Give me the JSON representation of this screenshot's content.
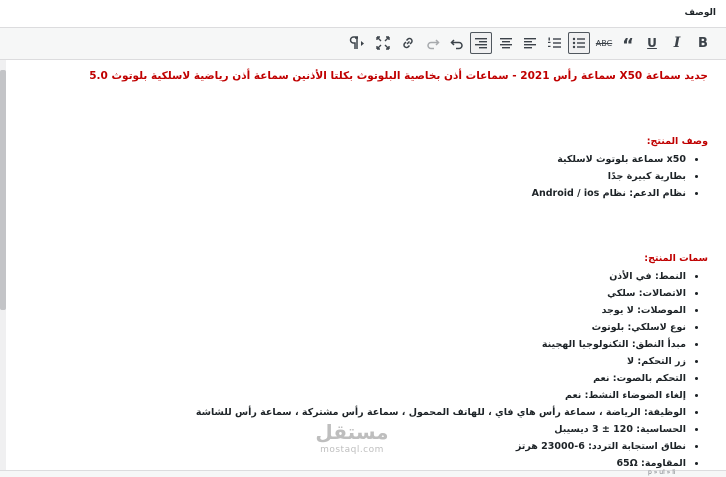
{
  "field_label": "الوصف",
  "toolbar": {
    "buttons": [
      {
        "name": "bold",
        "label": "B",
        "icon": "bold-icon"
      },
      {
        "name": "italic",
        "label": "I",
        "icon": "italic-icon"
      },
      {
        "name": "underline",
        "label": "U",
        "icon": "underline-icon"
      },
      {
        "name": "blockquote",
        "label": "“",
        "icon": "blockquote-icon"
      },
      {
        "name": "strikethrough",
        "label": "ABC",
        "icon": "strikethrough-icon"
      },
      {
        "name": "bullet-list",
        "icon": "bullet-list-icon",
        "active": true
      },
      {
        "name": "numbered-list",
        "icon": "numbered-list-icon"
      },
      {
        "name": "align-left",
        "icon": "align-left-icon"
      },
      {
        "name": "align-center",
        "icon": "align-center-icon"
      },
      {
        "name": "align-right",
        "icon": "align-right-icon",
        "active": true
      },
      {
        "name": "undo",
        "icon": "undo-icon"
      },
      {
        "name": "redo",
        "icon": "redo-icon",
        "disabled": true
      },
      {
        "name": "link",
        "icon": "link-icon"
      },
      {
        "name": "fullscreen",
        "icon": "fullscreen-icon"
      },
      {
        "name": "paragraph-direction",
        "icon": "pilcrow-rtl-icon"
      }
    ]
  },
  "content": {
    "headline": "جديد سماعة X50 سماعة رأس 2021 - سماعات أذن بخاصية البلوتوث بكلتا الأذنين سماعة أذن رياضية لاسلكية بلوتوث 5.0",
    "description_title": "وصف المنتج:",
    "description_items": [
      "x50 سماعة بلوتوث لاسلكية",
      "بطارية كبيرة جدًا",
      "نظام الدعم: نظام Android / ios"
    ],
    "features_title": "سمات المنتج:",
    "features_items": [
      "النمط: في الأذن",
      "الاتصالات: سلكي",
      "الموصلات: لا يوجد",
      "نوع لاسلكي: بلوتوث",
      "مبدأ النطق: التكنولوجيا الهجينة",
      "زر التحكم: لا",
      "التحكم بالصوت: نعم",
      "إلغاء الضوضاء النشط: نعم",
      "الوظيفة: الرياضة ، سماعة رأس هاي فاي ، للهاتف المحمول ، سماعة رأس مشتركة ، سماعة رأس للشاشة",
      "الحساسية: 120 ± 3 ديسيبل",
      "نطاق استجابة التردد: 6-23000 هرتز",
      "المقاومة: 65Ω"
    ]
  },
  "watermark": {
    "arabic": "مستقل",
    "latin": "mostaql.com"
  },
  "status": {
    "path": "p » ul » li"
  },
  "colors": {
    "accent_red": "#c00000",
    "toolbar_bg": "#f6f7f7",
    "border": "#dcdcde"
  }
}
